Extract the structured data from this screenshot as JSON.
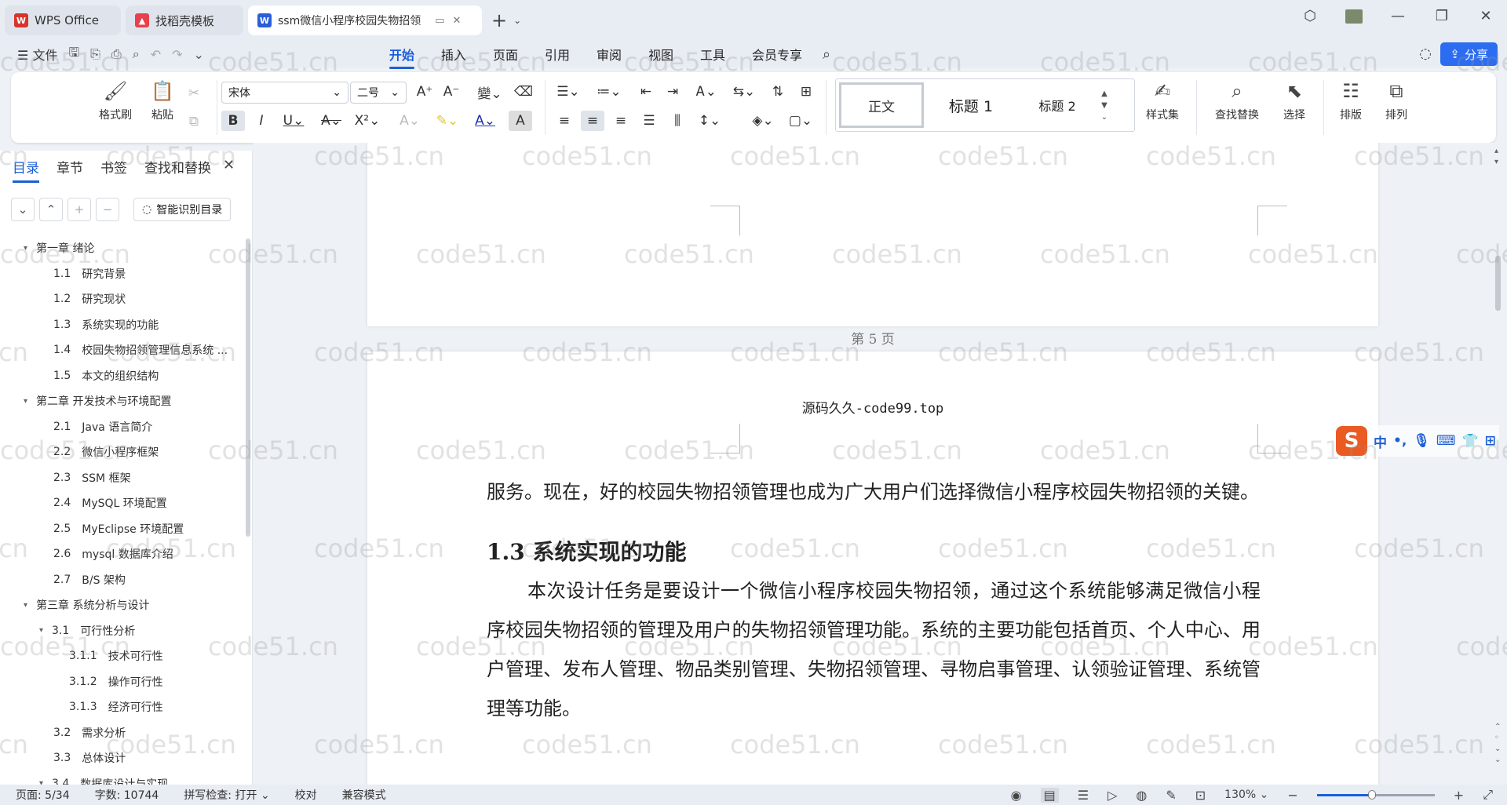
{
  "tabs": [
    {
      "label": "WPS Office",
      "logo": "W",
      "color": "#d9342b"
    },
    {
      "label": "找稻壳模板",
      "logo": "",
      "color": "#e8414e"
    },
    {
      "label": "ssm微信小程序校园失物招领",
      "logo": "W",
      "color": "#2b5fd8"
    }
  ],
  "menu": {
    "file": "文件",
    "items": [
      "开始",
      "插入",
      "页面",
      "引用",
      "审阅",
      "视图",
      "工具",
      "会员专享"
    ],
    "share": "分享"
  },
  "ribbon": {
    "format_painter": "格式刷",
    "paste": "粘贴",
    "font_name": "宋体",
    "font_size": "二号",
    "styles": [
      "正文",
      "标题 1",
      "标题 2"
    ],
    "style_set": "样式集",
    "find_replace": "查找替换",
    "select": "选择",
    "layout": "排版",
    "arrange": "排列"
  },
  "sidebar": {
    "tabs": [
      "目录",
      "章节",
      "书签",
      "查找和替换"
    ],
    "smart_button": "智能识别目录",
    "toc": [
      {
        "level": 0,
        "num": "",
        "label": "第一章  绪论",
        "caret": "▾"
      },
      {
        "level": 1,
        "num": "1.1",
        "label": "研究背景",
        "caret": ""
      },
      {
        "level": 1,
        "num": "1.2",
        "label": "研究现状",
        "caret": ""
      },
      {
        "level": 1,
        "num": "1.3",
        "label": "系统实现的功能",
        "caret": ""
      },
      {
        "level": 1,
        "num": "1.4",
        "label": "校园失物招领管理信息系统 ...",
        "caret": ""
      },
      {
        "level": 1,
        "num": "1.5",
        "label": "本文的组织结构",
        "caret": ""
      },
      {
        "level": 0,
        "num": "",
        "label": "第二章  开发技术与环境配置",
        "caret": "▾"
      },
      {
        "level": 1,
        "num": "2.1",
        "label": "Java 语言简介",
        "caret": ""
      },
      {
        "level": 1,
        "num": "2.2",
        "label": "微信小程序框架",
        "caret": ""
      },
      {
        "level": 1,
        "num": "2.3",
        "label": "SSM 框架",
        "caret": ""
      },
      {
        "level": 1,
        "num": "2.4",
        "label": "MySQL 环境配置",
        "caret": ""
      },
      {
        "level": 1,
        "num": "2.5",
        "label": "MyEclipse 环境配置",
        "caret": ""
      },
      {
        "level": 1,
        "num": "2.6",
        "label": "mysql 数据库介绍",
        "caret": ""
      },
      {
        "level": 1,
        "num": "2.7",
        "label": "B/S 架构",
        "caret": ""
      },
      {
        "level": 0,
        "num": "",
        "label": "第三章  系统分析与设计",
        "caret": "▾"
      },
      {
        "level": 1,
        "num": "3.1",
        "label": "可行性分析",
        "caret": "▾"
      },
      {
        "level": 2,
        "num": "3.1.1",
        "label": "技术可行性",
        "caret": ""
      },
      {
        "level": 2,
        "num": "3.1.2",
        "label": "操作可行性",
        "caret": ""
      },
      {
        "level": 2,
        "num": "3.1.3",
        "label": "经济可行性",
        "caret": ""
      },
      {
        "level": 1,
        "num": "3.2",
        "label": "需求分析",
        "caret": ""
      },
      {
        "level": 1,
        "num": "3.3",
        "label": "总体设计",
        "caret": ""
      },
      {
        "level": 1,
        "num": "3.4",
        "label": "数据库设计与实现",
        "caret": "▾"
      }
    ]
  },
  "document": {
    "page_number_label": "第  5  页",
    "header": "源码久久-code99.top",
    "para1": "服务。现在，好的校园失物招领管理也成为广大用户们选择微信小程序校园失物招领的关键。",
    "heading": "1.3  系统实现的功能",
    "para2": "本次设计任务是要设计一个微信小程序校园失物招领，通过这个系统能够满足微信小程序校园失物招领的管理及用户的失物招领管理功能。系统的主要功能包括首页、个人中心、用户管理、发布人管理、物品类别管理、失物招领管理、寻物启事管理、认领验证管理、系统管理等功能。"
  },
  "ime": {
    "items": [
      "中",
      "•,",
      "mic",
      "kbd",
      "shirt",
      "grid"
    ]
  },
  "status": {
    "page": "页面: 5/34",
    "words": "字数: 10744",
    "spell": "拼写检查: 打开",
    "proof": "校对",
    "compat": "兼容模式",
    "zoom": "130%",
    "zoom_fraction": 0.47
  },
  "watermark": "code51.cn"
}
